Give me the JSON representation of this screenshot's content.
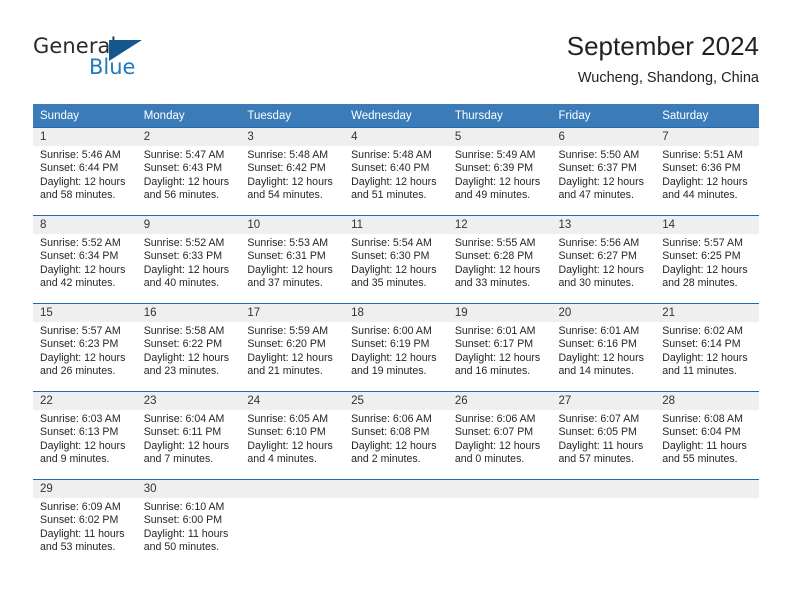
{
  "logo": {
    "word_one": "General",
    "word_two": "Blue",
    "triangle_color": "#14578f",
    "blue_color": "#1f7bc1"
  },
  "header": {
    "title": "September 2024",
    "subtitle": "Wucheng, Shandong, China"
  },
  "theme": {
    "header_bg": "#3b7cb8",
    "cell_border": "#1f6bb0",
    "daynum_band": "#efefef"
  },
  "weekday_headers": [
    "Sunday",
    "Monday",
    "Tuesday",
    "Wednesday",
    "Thursday",
    "Friday",
    "Saturday"
  ],
  "weeks": [
    [
      {
        "day": "1",
        "sunrise": "Sunrise: 5:46 AM",
        "sunset": "Sunset: 6:44 PM",
        "daylight_line1": "Daylight: 12 hours",
        "daylight_line2": "and 58 minutes."
      },
      {
        "day": "2",
        "sunrise": "Sunrise: 5:47 AM",
        "sunset": "Sunset: 6:43 PM",
        "daylight_line1": "Daylight: 12 hours",
        "daylight_line2": "and 56 minutes."
      },
      {
        "day": "3",
        "sunrise": "Sunrise: 5:48 AM",
        "sunset": "Sunset: 6:42 PM",
        "daylight_line1": "Daylight: 12 hours",
        "daylight_line2": "and 54 minutes."
      },
      {
        "day": "4",
        "sunrise": "Sunrise: 5:48 AM",
        "sunset": "Sunset: 6:40 PM",
        "daylight_line1": "Daylight: 12 hours",
        "daylight_line2": "and 51 minutes."
      },
      {
        "day": "5",
        "sunrise": "Sunrise: 5:49 AM",
        "sunset": "Sunset: 6:39 PM",
        "daylight_line1": "Daylight: 12 hours",
        "daylight_line2": "and 49 minutes."
      },
      {
        "day": "6",
        "sunrise": "Sunrise: 5:50 AM",
        "sunset": "Sunset: 6:37 PM",
        "daylight_line1": "Daylight: 12 hours",
        "daylight_line2": "and 47 minutes."
      },
      {
        "day": "7",
        "sunrise": "Sunrise: 5:51 AM",
        "sunset": "Sunset: 6:36 PM",
        "daylight_line1": "Daylight: 12 hours",
        "daylight_line2": "and 44 minutes."
      }
    ],
    [
      {
        "day": "8",
        "sunrise": "Sunrise: 5:52 AM",
        "sunset": "Sunset: 6:34 PM",
        "daylight_line1": "Daylight: 12 hours",
        "daylight_line2": "and 42 minutes."
      },
      {
        "day": "9",
        "sunrise": "Sunrise: 5:52 AM",
        "sunset": "Sunset: 6:33 PM",
        "daylight_line1": "Daylight: 12 hours",
        "daylight_line2": "and 40 minutes."
      },
      {
        "day": "10",
        "sunrise": "Sunrise: 5:53 AM",
        "sunset": "Sunset: 6:31 PM",
        "daylight_line1": "Daylight: 12 hours",
        "daylight_line2": "and 37 minutes."
      },
      {
        "day": "11",
        "sunrise": "Sunrise: 5:54 AM",
        "sunset": "Sunset: 6:30 PM",
        "daylight_line1": "Daylight: 12 hours",
        "daylight_line2": "and 35 minutes."
      },
      {
        "day": "12",
        "sunrise": "Sunrise: 5:55 AM",
        "sunset": "Sunset: 6:28 PM",
        "daylight_line1": "Daylight: 12 hours",
        "daylight_line2": "and 33 minutes."
      },
      {
        "day": "13",
        "sunrise": "Sunrise: 5:56 AM",
        "sunset": "Sunset: 6:27 PM",
        "daylight_line1": "Daylight: 12 hours",
        "daylight_line2": "and 30 minutes."
      },
      {
        "day": "14",
        "sunrise": "Sunrise: 5:57 AM",
        "sunset": "Sunset: 6:25 PM",
        "daylight_line1": "Daylight: 12 hours",
        "daylight_line2": "and 28 minutes."
      }
    ],
    [
      {
        "day": "15",
        "sunrise": "Sunrise: 5:57 AM",
        "sunset": "Sunset: 6:23 PM",
        "daylight_line1": "Daylight: 12 hours",
        "daylight_line2": "and 26 minutes."
      },
      {
        "day": "16",
        "sunrise": "Sunrise: 5:58 AM",
        "sunset": "Sunset: 6:22 PM",
        "daylight_line1": "Daylight: 12 hours",
        "daylight_line2": "and 23 minutes."
      },
      {
        "day": "17",
        "sunrise": "Sunrise: 5:59 AM",
        "sunset": "Sunset: 6:20 PM",
        "daylight_line1": "Daylight: 12 hours",
        "daylight_line2": "and 21 minutes."
      },
      {
        "day": "18",
        "sunrise": "Sunrise: 6:00 AM",
        "sunset": "Sunset: 6:19 PM",
        "daylight_line1": "Daylight: 12 hours",
        "daylight_line2": "and 19 minutes."
      },
      {
        "day": "19",
        "sunrise": "Sunrise: 6:01 AM",
        "sunset": "Sunset: 6:17 PM",
        "daylight_line1": "Daylight: 12 hours",
        "daylight_line2": "and 16 minutes."
      },
      {
        "day": "20",
        "sunrise": "Sunrise: 6:01 AM",
        "sunset": "Sunset: 6:16 PM",
        "daylight_line1": "Daylight: 12 hours",
        "daylight_line2": "and 14 minutes."
      },
      {
        "day": "21",
        "sunrise": "Sunrise: 6:02 AM",
        "sunset": "Sunset: 6:14 PM",
        "daylight_line1": "Daylight: 12 hours",
        "daylight_line2": "and 11 minutes."
      }
    ],
    [
      {
        "day": "22",
        "sunrise": "Sunrise: 6:03 AM",
        "sunset": "Sunset: 6:13 PM",
        "daylight_line1": "Daylight: 12 hours",
        "daylight_line2": "and 9 minutes."
      },
      {
        "day": "23",
        "sunrise": "Sunrise: 6:04 AM",
        "sunset": "Sunset: 6:11 PM",
        "daylight_line1": "Daylight: 12 hours",
        "daylight_line2": "and 7 minutes."
      },
      {
        "day": "24",
        "sunrise": "Sunrise: 6:05 AM",
        "sunset": "Sunset: 6:10 PM",
        "daylight_line1": "Daylight: 12 hours",
        "daylight_line2": "and 4 minutes."
      },
      {
        "day": "25",
        "sunrise": "Sunrise: 6:06 AM",
        "sunset": "Sunset: 6:08 PM",
        "daylight_line1": "Daylight: 12 hours",
        "daylight_line2": "and 2 minutes."
      },
      {
        "day": "26",
        "sunrise": "Sunrise: 6:06 AM",
        "sunset": "Sunset: 6:07 PM",
        "daylight_line1": "Daylight: 12 hours",
        "daylight_line2": "and 0 minutes."
      },
      {
        "day": "27",
        "sunrise": "Sunrise: 6:07 AM",
        "sunset": "Sunset: 6:05 PM",
        "daylight_line1": "Daylight: 11 hours",
        "daylight_line2": "and 57 minutes."
      },
      {
        "day": "28",
        "sunrise": "Sunrise: 6:08 AM",
        "sunset": "Sunset: 6:04 PM",
        "daylight_line1": "Daylight: 11 hours",
        "daylight_line2": "and 55 minutes."
      }
    ],
    [
      {
        "day": "29",
        "sunrise": "Sunrise: 6:09 AM",
        "sunset": "Sunset: 6:02 PM",
        "daylight_line1": "Daylight: 11 hours",
        "daylight_line2": "and 53 minutes."
      },
      {
        "day": "30",
        "sunrise": "Sunrise: 6:10 AM",
        "sunset": "Sunset: 6:00 PM",
        "daylight_line1": "Daylight: 11 hours",
        "daylight_line2": "and 50 minutes."
      },
      {
        "day": "",
        "sunrise": "",
        "sunset": "",
        "daylight_line1": "",
        "daylight_line2": ""
      },
      {
        "day": "",
        "sunrise": "",
        "sunset": "",
        "daylight_line1": "",
        "daylight_line2": ""
      },
      {
        "day": "",
        "sunrise": "",
        "sunset": "",
        "daylight_line1": "",
        "daylight_line2": ""
      },
      {
        "day": "",
        "sunrise": "",
        "sunset": "",
        "daylight_line1": "",
        "daylight_line2": ""
      },
      {
        "day": "",
        "sunrise": "",
        "sunset": "",
        "daylight_line1": "",
        "daylight_line2": ""
      }
    ]
  ]
}
